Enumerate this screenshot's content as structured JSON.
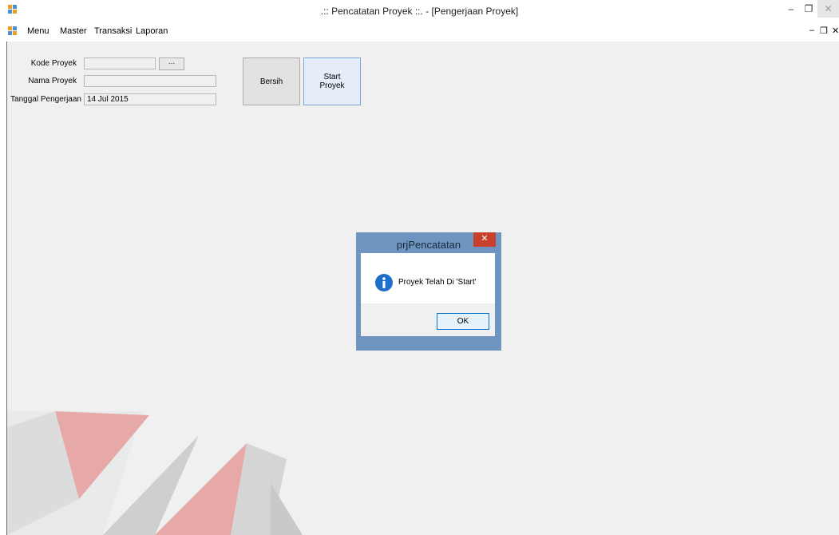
{
  "window": {
    "title": ".:: Pencatatan Proyek ::. - [Pengerjaan Proyek]",
    "minimize": "–",
    "maximize": "❐",
    "close": "✕"
  },
  "menubar": {
    "items": [
      "Menu",
      "Master",
      "Transaksi",
      "Laporan"
    ],
    "mdi_min": "–",
    "mdi_restore": "❐",
    "mdi_close": "✕"
  },
  "form": {
    "kode_label": "Kode Proyek",
    "kode_value": "",
    "browse_label": "...",
    "nama_label": "Nama Proyek",
    "nama_value": "",
    "tanggal_label": "Tanggal Pengerjaan",
    "tanggal_value": "14 Jul 2015",
    "bersih_label": "Bersih",
    "start_label_1": "Start",
    "start_label_2": "Proyek"
  },
  "dialog": {
    "title": "prjPencatatan",
    "close": "✕",
    "icon": "info-icon",
    "message": "Proyek Telah Di 'Start'",
    "ok_label": "OK"
  },
  "colors": {
    "client_bg": "#f0f0f0",
    "dialog_frame": "#6d95c0",
    "dialog_close": "#c7402c",
    "info_icon": "#1e6fc9",
    "watermark_red": "#e7a8a8",
    "watermark_gray": "#c9c9c9"
  }
}
